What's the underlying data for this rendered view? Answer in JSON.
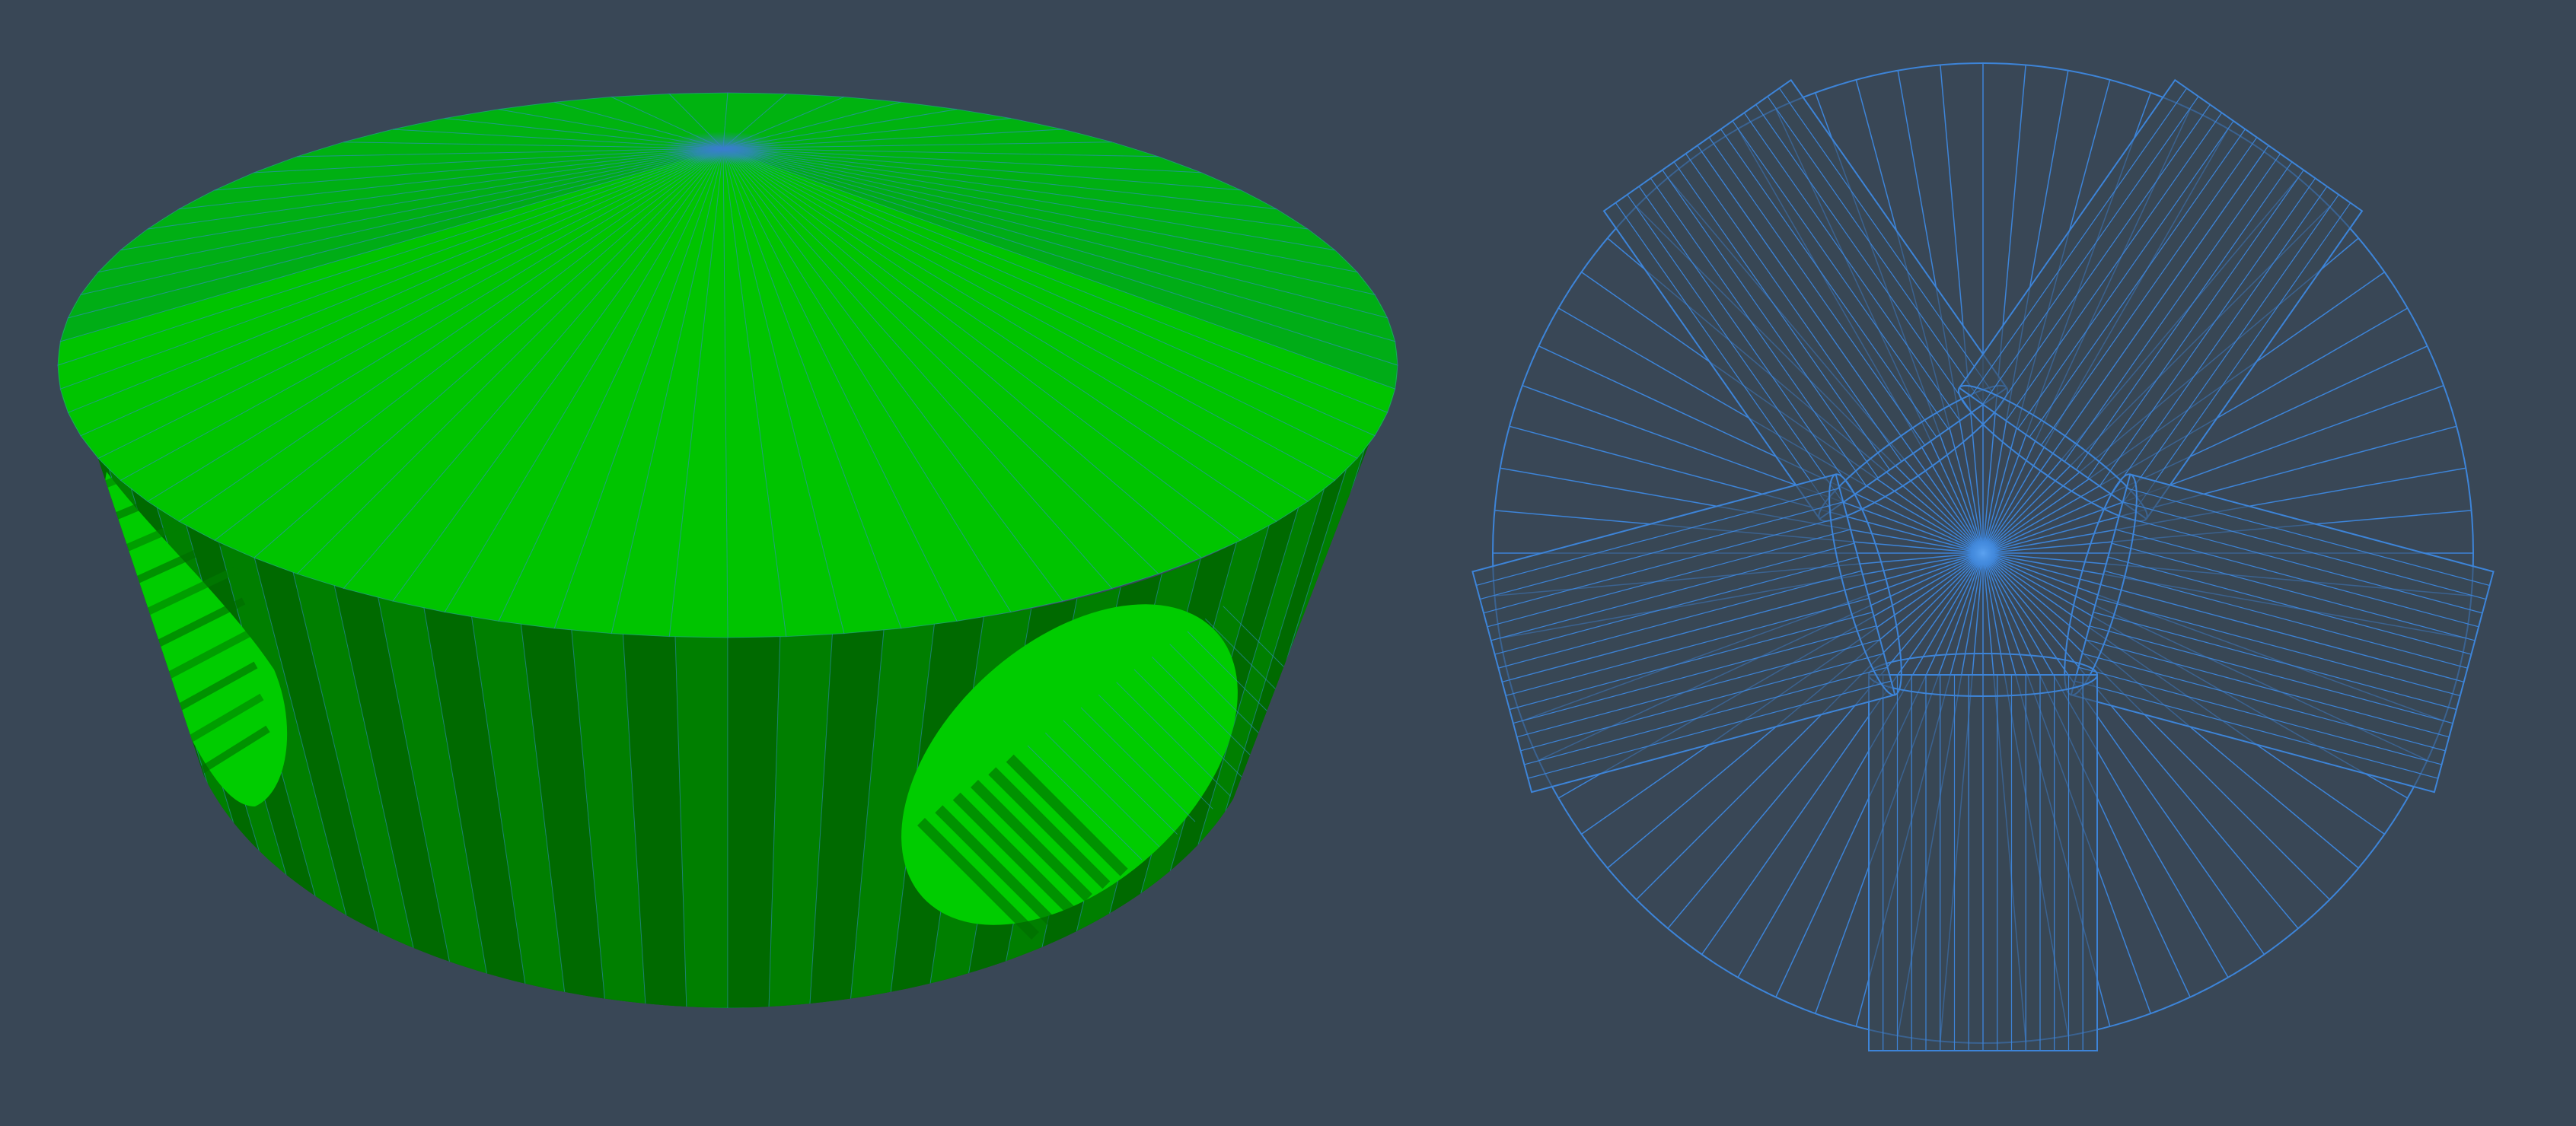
{
  "viewport": {
    "background": "#394756"
  },
  "solid_view": {
    "face_colors": {
      "top_light": "#00c400",
      "top_dark": "#00a51d",
      "side_dark": "#006a00",
      "side_mid": "#007f00",
      "hole_light": "#00cc00",
      "hole_dark": "#006a00"
    },
    "edge_color": "#2f8fbf",
    "center_marker_color": "#3a7ccf"
  },
  "wireframe_view": {
    "line_color": "#3d84d8",
    "center_marker_color": "#4a90e2"
  }
}
